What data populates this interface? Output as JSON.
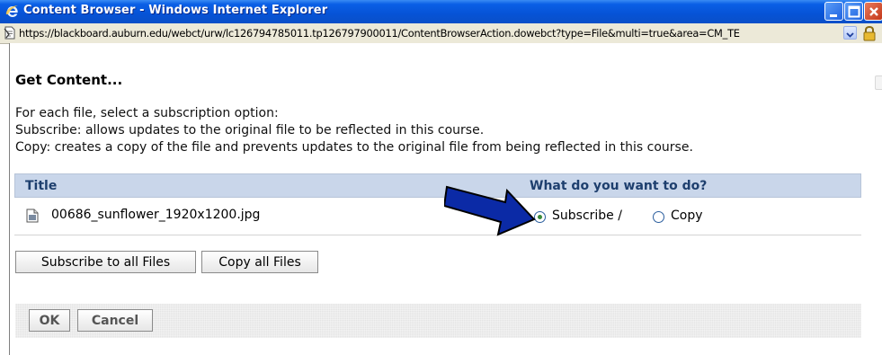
{
  "window": {
    "title": "Content Browser - Windows Internet Explorer",
    "url": "https://blackboard.auburn.edu/webct/urw/lc126794785011.tp126797900011/ContentBrowserAction.dowebct?type=File&multi=true&area=CM_TE"
  },
  "page": {
    "heading": "Get Content...",
    "description": [
      "For each file, select a subscription option:",
      "Subscribe: allows updates to the original file to be reflected in this course.",
      "Copy: creates a copy of the file and prevents updates to the original file from being reflected in this course."
    ]
  },
  "table": {
    "headers": {
      "title": "Title",
      "action": "What do you want to do?"
    },
    "rows": [
      {
        "file_name": "00686_sunflower_1920x1200.jpg",
        "subscribe_label": "Subscribe /",
        "copy_label": "Copy",
        "selected": "subscribe"
      }
    ]
  },
  "buttons": {
    "subscribe_all": "Subscribe to all Files",
    "copy_all": "Copy all Files",
    "ok": "OK",
    "cancel": "Cancel"
  },
  "colors": {
    "titlebar": "#0a5fe6",
    "table_header": "#c9d6ea",
    "annotation_arrow": "#0b2aa6"
  },
  "icons": [
    "ie-logo-icon",
    "minimize-icon",
    "maximize-icon",
    "close-icon",
    "page-icon",
    "dropdown-arrow-icon",
    "lock-icon",
    "file-icon",
    "annotation-arrow-icon"
  ]
}
